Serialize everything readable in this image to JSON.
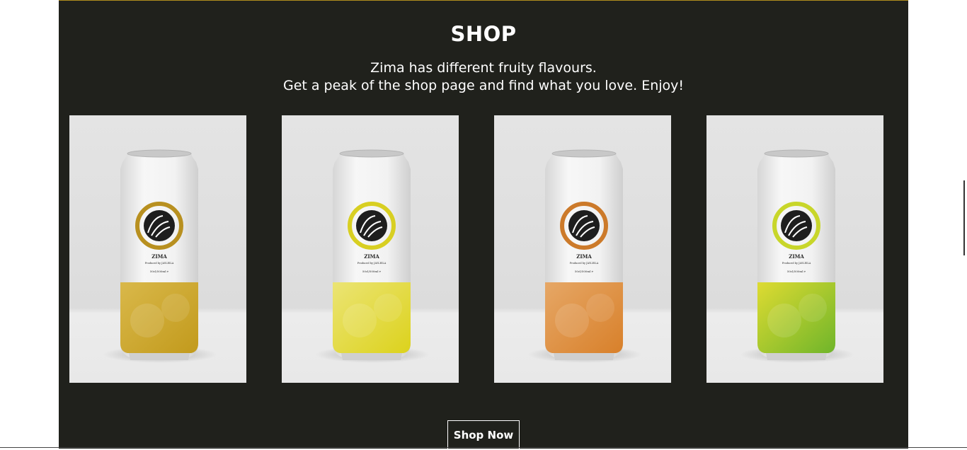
{
  "shop": {
    "title": "SHOP",
    "subtitle_line1": "Zima has different fruity flavours.",
    "subtitle_line2": "Get a peak of the shop page and find what you love. Enjoy!",
    "button_label": "Shop Now"
  },
  "products": [
    {
      "brand": "ZIMA",
      "producer": "Produced by JAYLEILA",
      "volume": "50cl/500ml ℮",
      "color": "#c29a1c",
      "color_light": "#d9b84a",
      "ring": "#b89020",
      "icon": "zima-logo-icon"
    },
    {
      "brand": "ZIMA",
      "producer": "Produced by JAYLEILA",
      "volume": "50cl/500ml ℮",
      "color": "#dcd21c",
      "color_light": "#ebe474",
      "ring": "#d8cf22",
      "icon": "zima-logo-icon"
    },
    {
      "brand": "ZIMA",
      "producer": "Produced by JAYLEILA",
      "volume": "50cl/500ml ℮",
      "color": "#d8802a",
      "color_light": "#e6a766",
      "ring": "#cc7a2a",
      "icon": "zima-logo-icon"
    },
    {
      "brand": "ZIMA",
      "producer": "Produced by JAYLEILA",
      "volume": "50cl/500ml ℮",
      "color": "#6fb52a",
      "color_light": "#dedb32",
      "ring": "#c8d62a",
      "icon": "zima-logo-icon"
    }
  ],
  "colors": {
    "section_bg": "#20211c",
    "accent_border": "#b08d1e",
    "text": "#ffffff"
  }
}
